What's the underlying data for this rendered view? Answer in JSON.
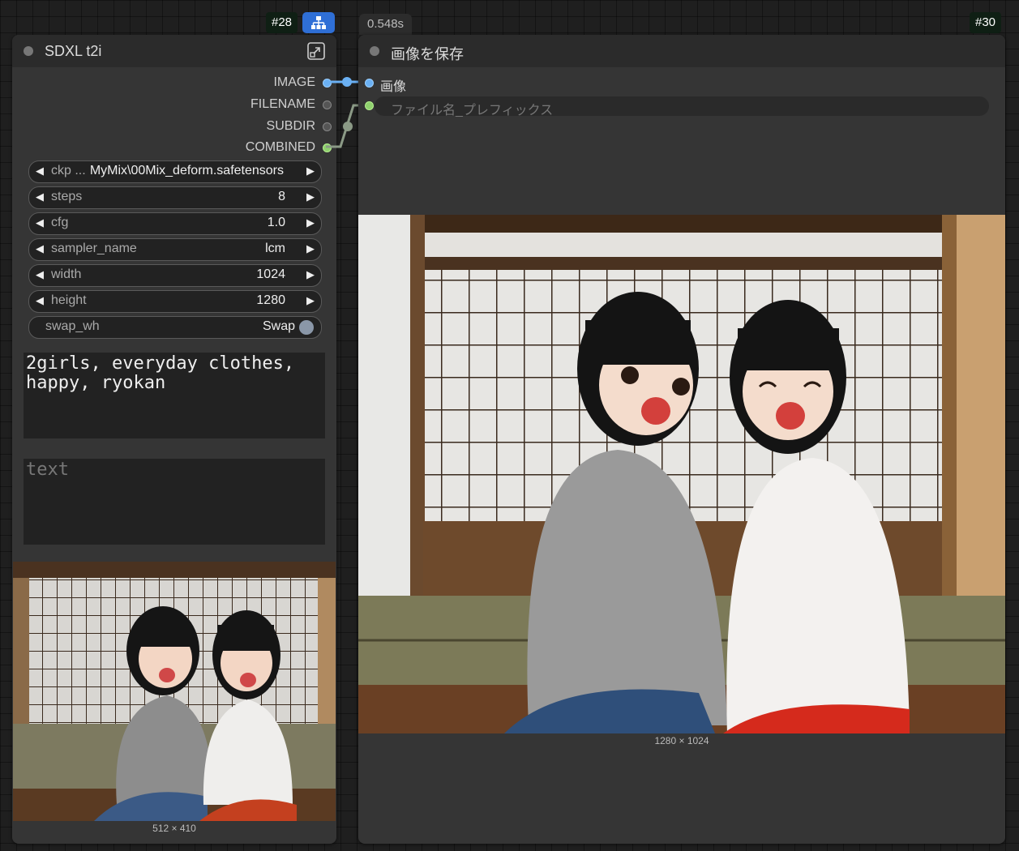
{
  "badges": {
    "node_a_id": "#28",
    "node_b_id": "#30",
    "exec_time": "0.548s"
  },
  "node_a": {
    "title": "SDXL t2i",
    "outputs": [
      "IMAGE",
      "FILENAME",
      "SUBDIR",
      "COMBINED"
    ],
    "widgets": [
      {
        "label": "ckp ...",
        "value": "MyMix\\00Mix_deform.safetensors"
      },
      {
        "label": "steps",
        "value": "8"
      },
      {
        "label": "cfg",
        "value": "1.0"
      },
      {
        "label": "sampler_name",
        "value": "lcm"
      },
      {
        "label": "width",
        "value": "1024"
      },
      {
        "label": "height",
        "value": "1280"
      }
    ],
    "toggle": {
      "label": "swap_wh",
      "value": "Swap"
    },
    "prompt_text": "2girls, everyday clothes,\nhappy, ryokan",
    "negative_placeholder": "text",
    "preview_size": "512 × 410"
  },
  "node_b": {
    "title": "画像を保存",
    "input_image": "画像",
    "filename_placeholder": "ファイル名_プレフィックス",
    "preview_size": "1280 × 1024"
  },
  "colors": {
    "image_link": "#6ab0f3",
    "string_link": "#8fd06e",
    "graph_badge": "#2f6fd6",
    "node_bg": "#353535"
  },
  "icons": [
    "graph-icon",
    "expand-icon"
  ]
}
